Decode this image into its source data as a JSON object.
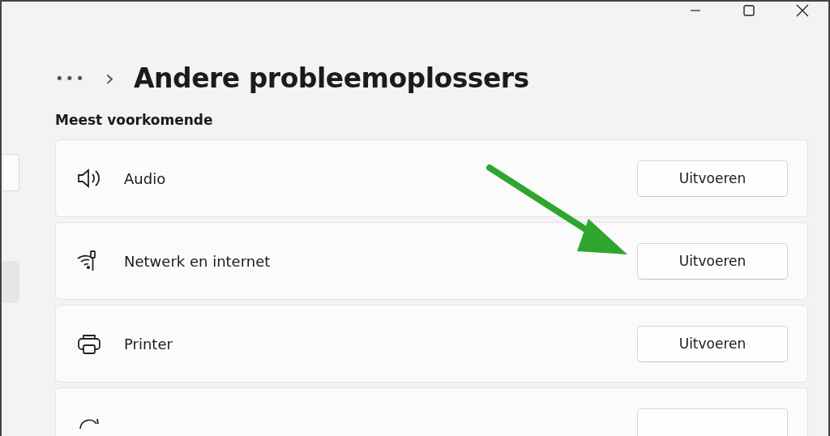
{
  "breadcrumb": {
    "more": "•••",
    "separator": "›",
    "title": "Andere probleemoplossers"
  },
  "section": {
    "heading": "Meest voorkomende",
    "items": [
      {
        "kind": "audio",
        "label": "Audio",
        "button": "Uitvoeren"
      },
      {
        "kind": "network",
        "label": "Netwerk en internet",
        "button": "Uitvoeren"
      },
      {
        "kind": "printer",
        "label": "Printer",
        "button": "Uitvoeren"
      },
      {
        "kind": "partial"
      }
    ]
  }
}
